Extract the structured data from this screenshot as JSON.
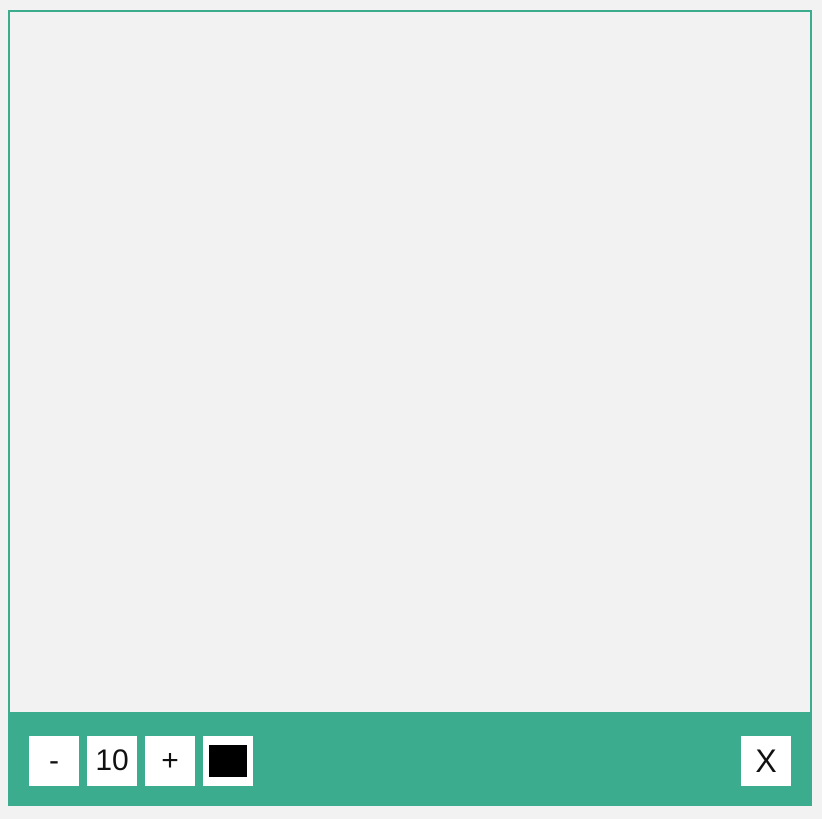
{
  "toolbar": {
    "decrease_label": "-",
    "brush_size": "10",
    "increase_label": "+",
    "color_value": "#000000",
    "close_label": "X"
  },
  "colors": {
    "accent": "#3cac8f",
    "canvas_background": "#f2f2f2"
  }
}
